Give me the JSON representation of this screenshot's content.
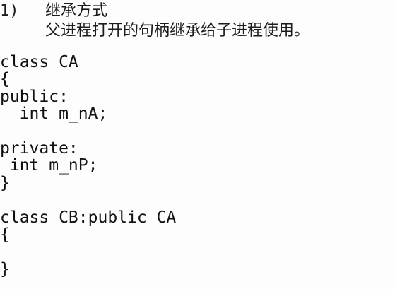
{
  "section": {
    "number": "1)",
    "title": "继承方式",
    "description": "父进程打开的句柄继承给子进程使用。"
  },
  "code": {
    "lines": [
      "class CA",
      "{",
      "public:",
      "  int m_nA;",
      "",
      "private:",
      " int m_nP;",
      "}",
      "",
      "class CB:public CA",
      "{",
      "",
      "}"
    ]
  }
}
